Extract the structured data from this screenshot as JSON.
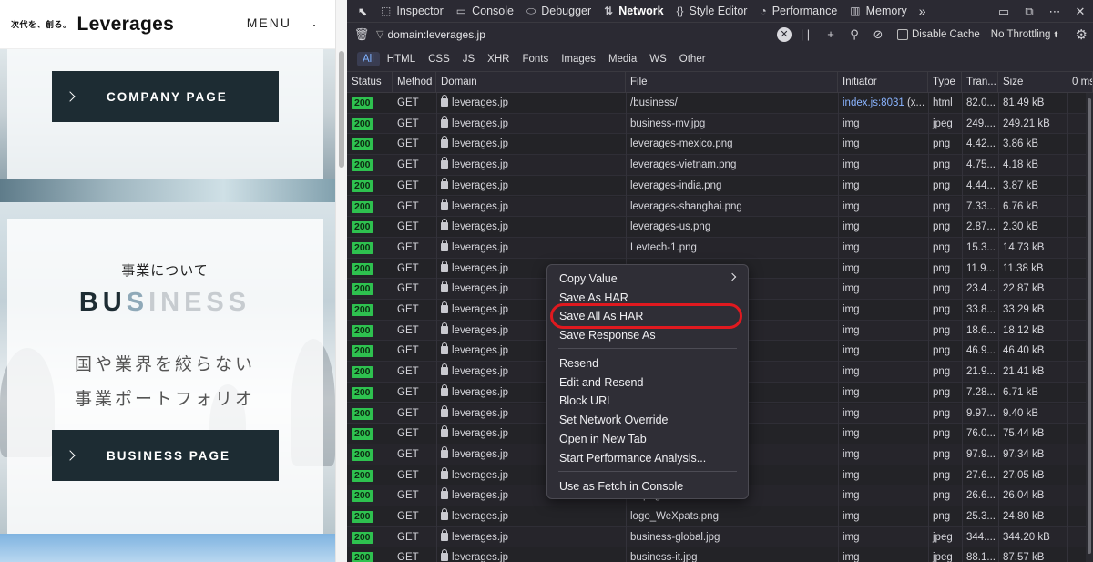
{
  "site": {
    "logo_tagline": "次代を、創る。",
    "logo_name": "Leverages",
    "menu_label": "MENU",
    "company_button": "COMPANY PAGE",
    "business_subtitle": "事業について",
    "business_title_dark": "BU",
    "business_title_blue": "S",
    "business_title_light": "INESS",
    "business_line1": "国や業界を絞らない",
    "business_line2": "事業ポートフォリオ",
    "business_button": "BUSINESS PAGE"
  },
  "devtools": {
    "tabs": [
      {
        "label": "Inspector",
        "icon": "⬚"
      },
      {
        "label": "Console",
        "icon": "▭"
      },
      {
        "label": "Debugger",
        "icon": "⬭"
      },
      {
        "label": "Network",
        "icon": "⇅"
      },
      {
        "label": "Style Editor",
        "icon": "{}"
      },
      {
        "label": "Performance",
        "icon": "◔"
      },
      {
        "label": "Memory",
        "icon": "▥"
      }
    ],
    "more_tabs": "»",
    "filter_value": "domain:leverages.jp",
    "pause_icon": "| |",
    "add_icon": "+",
    "search_icon": "⚲",
    "block_icon": "⊘",
    "disable_cache": "Disable Cache",
    "throttling": "No Throttling",
    "type_filters": [
      "All",
      "HTML",
      "CSS",
      "JS",
      "XHR",
      "Fonts",
      "Images",
      "Media",
      "WS",
      "Other"
    ],
    "columns": [
      "Status",
      "Method",
      "Domain",
      "File",
      "Initiator",
      "Type",
      "Tran...",
      "Size",
      "0 ms"
    ],
    "rows": [
      {
        "status": "200",
        "method": "GET",
        "domain": "leverages.jp",
        "file": "/business/",
        "initiator": "index.js:8031",
        "initiator_suffix": " (x...",
        "type": "html",
        "transferred": "82.0...",
        "size": "81.49 kB"
      },
      {
        "status": "200",
        "method": "GET",
        "domain": "leverages.jp",
        "file": "business-mv.jpg",
        "initiator": "img",
        "type": "jpeg",
        "transferred": "249....",
        "size": "249.21 kB"
      },
      {
        "status": "200",
        "method": "GET",
        "domain": "leverages.jp",
        "file": "leverages-mexico.png",
        "initiator": "img",
        "type": "png",
        "transferred": "4.42...",
        "size": "3.86 kB"
      },
      {
        "status": "200",
        "method": "GET",
        "domain": "leverages.jp",
        "file": "leverages-vietnam.png",
        "initiator": "img",
        "type": "png",
        "transferred": "4.75...",
        "size": "4.18 kB"
      },
      {
        "status": "200",
        "method": "GET",
        "domain": "leverages.jp",
        "file": "leverages-india.png",
        "initiator": "img",
        "type": "png",
        "transferred": "4.44...",
        "size": "3.87 kB"
      },
      {
        "status": "200",
        "method": "GET",
        "domain": "leverages.jp",
        "file": "leverages-shanghai.png",
        "initiator": "img",
        "type": "png",
        "transferred": "7.33...",
        "size": "6.76 kB"
      },
      {
        "status": "200",
        "method": "GET",
        "domain": "leverages.jp",
        "file": "leverages-us.png",
        "initiator": "img",
        "type": "png",
        "transferred": "2.87...",
        "size": "2.30 kB"
      },
      {
        "status": "200",
        "method": "GET",
        "domain": "leverages.jp",
        "file": "Levtech-1.png",
        "initiator": "img",
        "type": "png",
        "transferred": "15.3...",
        "size": "14.73 kB"
      },
      {
        "status": "200",
        "method": "GET",
        "domain": "leverages.jp",
        "file": "",
        "initiator": "img",
        "type": "png",
        "transferred": "11.9...",
        "size": "11.38 kB"
      },
      {
        "status": "200",
        "method": "GET",
        "domain": "leverages.jp",
        "file": "",
        "initiator": "img",
        "type": "png",
        "transferred": "23.4...",
        "size": "22.87 kB"
      },
      {
        "status": "200",
        "method": "GET",
        "domain": "leverages.jp",
        "file": "",
        "initiator": "img",
        "type": "png",
        "transferred": "33.8...",
        "size": "33.29 kB"
      },
      {
        "status": "200",
        "method": "GET",
        "domain": "leverages.jp",
        "file": "",
        "initiator": "img",
        "type": "png",
        "transferred": "18.6...",
        "size": "18.12 kB"
      },
      {
        "status": "200",
        "method": "GET",
        "domain": "leverages.jp",
        "file": ".png",
        "initiator": "img",
        "type": "png",
        "transferred": "46.9...",
        "size": "46.40 kB"
      },
      {
        "status": "200",
        "method": "GET",
        "domain": "leverages.jp",
        "file": "",
        "initiator": "img",
        "type": "png",
        "transferred": "21.9...",
        "size": "21.41 kB"
      },
      {
        "status": "200",
        "method": "GET",
        "domain": "leverages.jp",
        "file": "",
        "initiator": "img",
        "type": "png",
        "transferred": "7.28...",
        "size": "6.71 kB"
      },
      {
        "status": "200",
        "method": "GET",
        "domain": "leverages.jp",
        "file": "",
        "initiator": "img",
        "type": "png",
        "transferred": "9.97...",
        "size": "9.40 kB"
      },
      {
        "status": "200",
        "method": "GET",
        "domain": "leverages.jp",
        "file": "b03e6c184fe.png",
        "initiator": "img",
        "type": "png",
        "transferred": "76.0...",
        "size": "75.44 kB"
      },
      {
        "status": "200",
        "method": "GET",
        "domain": "leverages.jp",
        "file": "58dce54f65f.png",
        "initiator": "img",
        "type": "png",
        "transferred": "97.9...",
        "size": "97.34 kB"
      },
      {
        "status": "200",
        "method": "GET",
        "domain": "leverages.jp",
        "file": "",
        "initiator": "img",
        "type": "png",
        "transferred": "27.6...",
        "size": "27.05 kB"
      },
      {
        "status": "200",
        "method": "GET",
        "domain": "leverages.jp",
        "file": "IA.png",
        "initiator": "img",
        "type": "png",
        "transferred": "26.6...",
        "size": "26.04 kB"
      },
      {
        "status": "200",
        "method": "GET",
        "domain": "leverages.jp",
        "file": "logo_WeXpats.png",
        "initiator": "img",
        "type": "png",
        "transferred": "25.3...",
        "size": "24.80 kB"
      },
      {
        "status": "200",
        "method": "GET",
        "domain": "leverages.jp",
        "file": "business-global.jpg",
        "initiator": "img",
        "type": "jpeg",
        "transferred": "344....",
        "size": "344.20 kB"
      },
      {
        "status": "200",
        "method": "GET",
        "domain": "leverages.jp",
        "file": "business-it.jpg",
        "initiator": "img",
        "type": "jpeg",
        "transferred": "88.1...",
        "size": "87.57 kB"
      }
    ]
  },
  "context_menu": {
    "items": [
      "Copy Value",
      "Save As HAR",
      "Save All As HAR",
      "Save Response As",
      "Resend",
      "Edit and Resend",
      "Block URL",
      "Set Network Override",
      "Open in New Tab",
      "Start Performance Analysis...",
      "Use as Fetch in Console"
    ]
  }
}
